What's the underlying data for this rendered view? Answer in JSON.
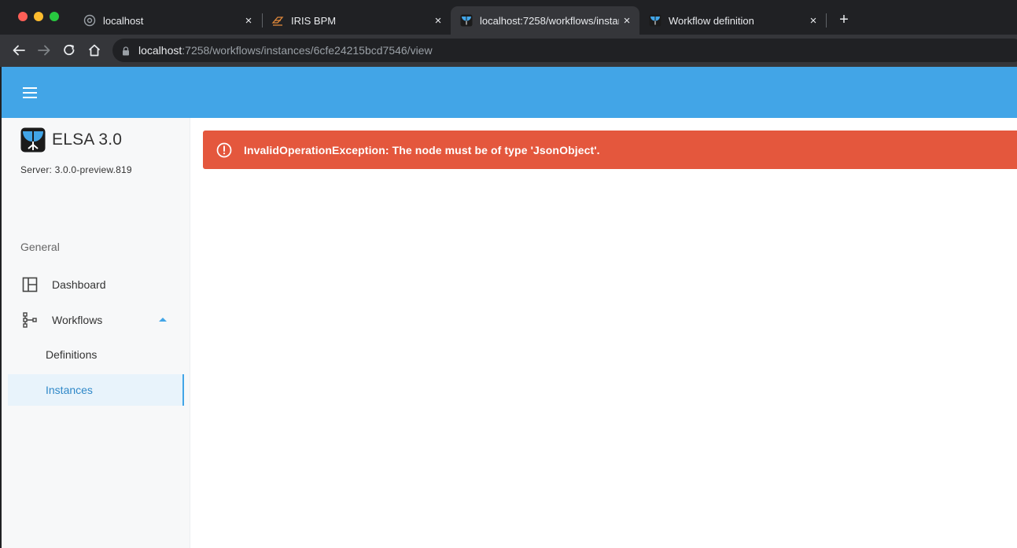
{
  "browser": {
    "tabs": [
      {
        "title": "localhost",
        "icon": "globe-icon",
        "active": false
      },
      {
        "title": "IRIS BPM",
        "icon": "iris-logo-icon",
        "active": false
      },
      {
        "title": "localhost:7258/workflows/instances/6cfe24215bcd7546/view",
        "icon": "elsa-logo-icon",
        "active": true
      },
      {
        "title": "Workflow definition",
        "icon": "elsa-logo-icon",
        "active": false
      }
    ],
    "close_glyph": "×",
    "new_tab_glyph": "+",
    "url_host": "localhost",
    "url_rest": ":7258/workflows/instances/6cfe24215bcd7546/view"
  },
  "sidebar": {
    "brand": "ELSA 3.0",
    "server": "Server: 3.0.0-preview.819",
    "section": "General",
    "items": [
      {
        "label": "Dashboard",
        "icon": "dashboard-icon"
      },
      {
        "label": "Workflows",
        "icon": "workflow-tree-icon",
        "expanded": true
      }
    ],
    "sub_items": [
      {
        "label": "Definitions",
        "active": false
      },
      {
        "label": "Instances",
        "active": true
      }
    ]
  },
  "alert": {
    "message": "InvalidOperationException: The node must be of type 'JsonObject'.",
    "color": "#e4573d"
  },
  "colors": {
    "appbar": "#42a5e7",
    "accent": "#42a5e7"
  }
}
